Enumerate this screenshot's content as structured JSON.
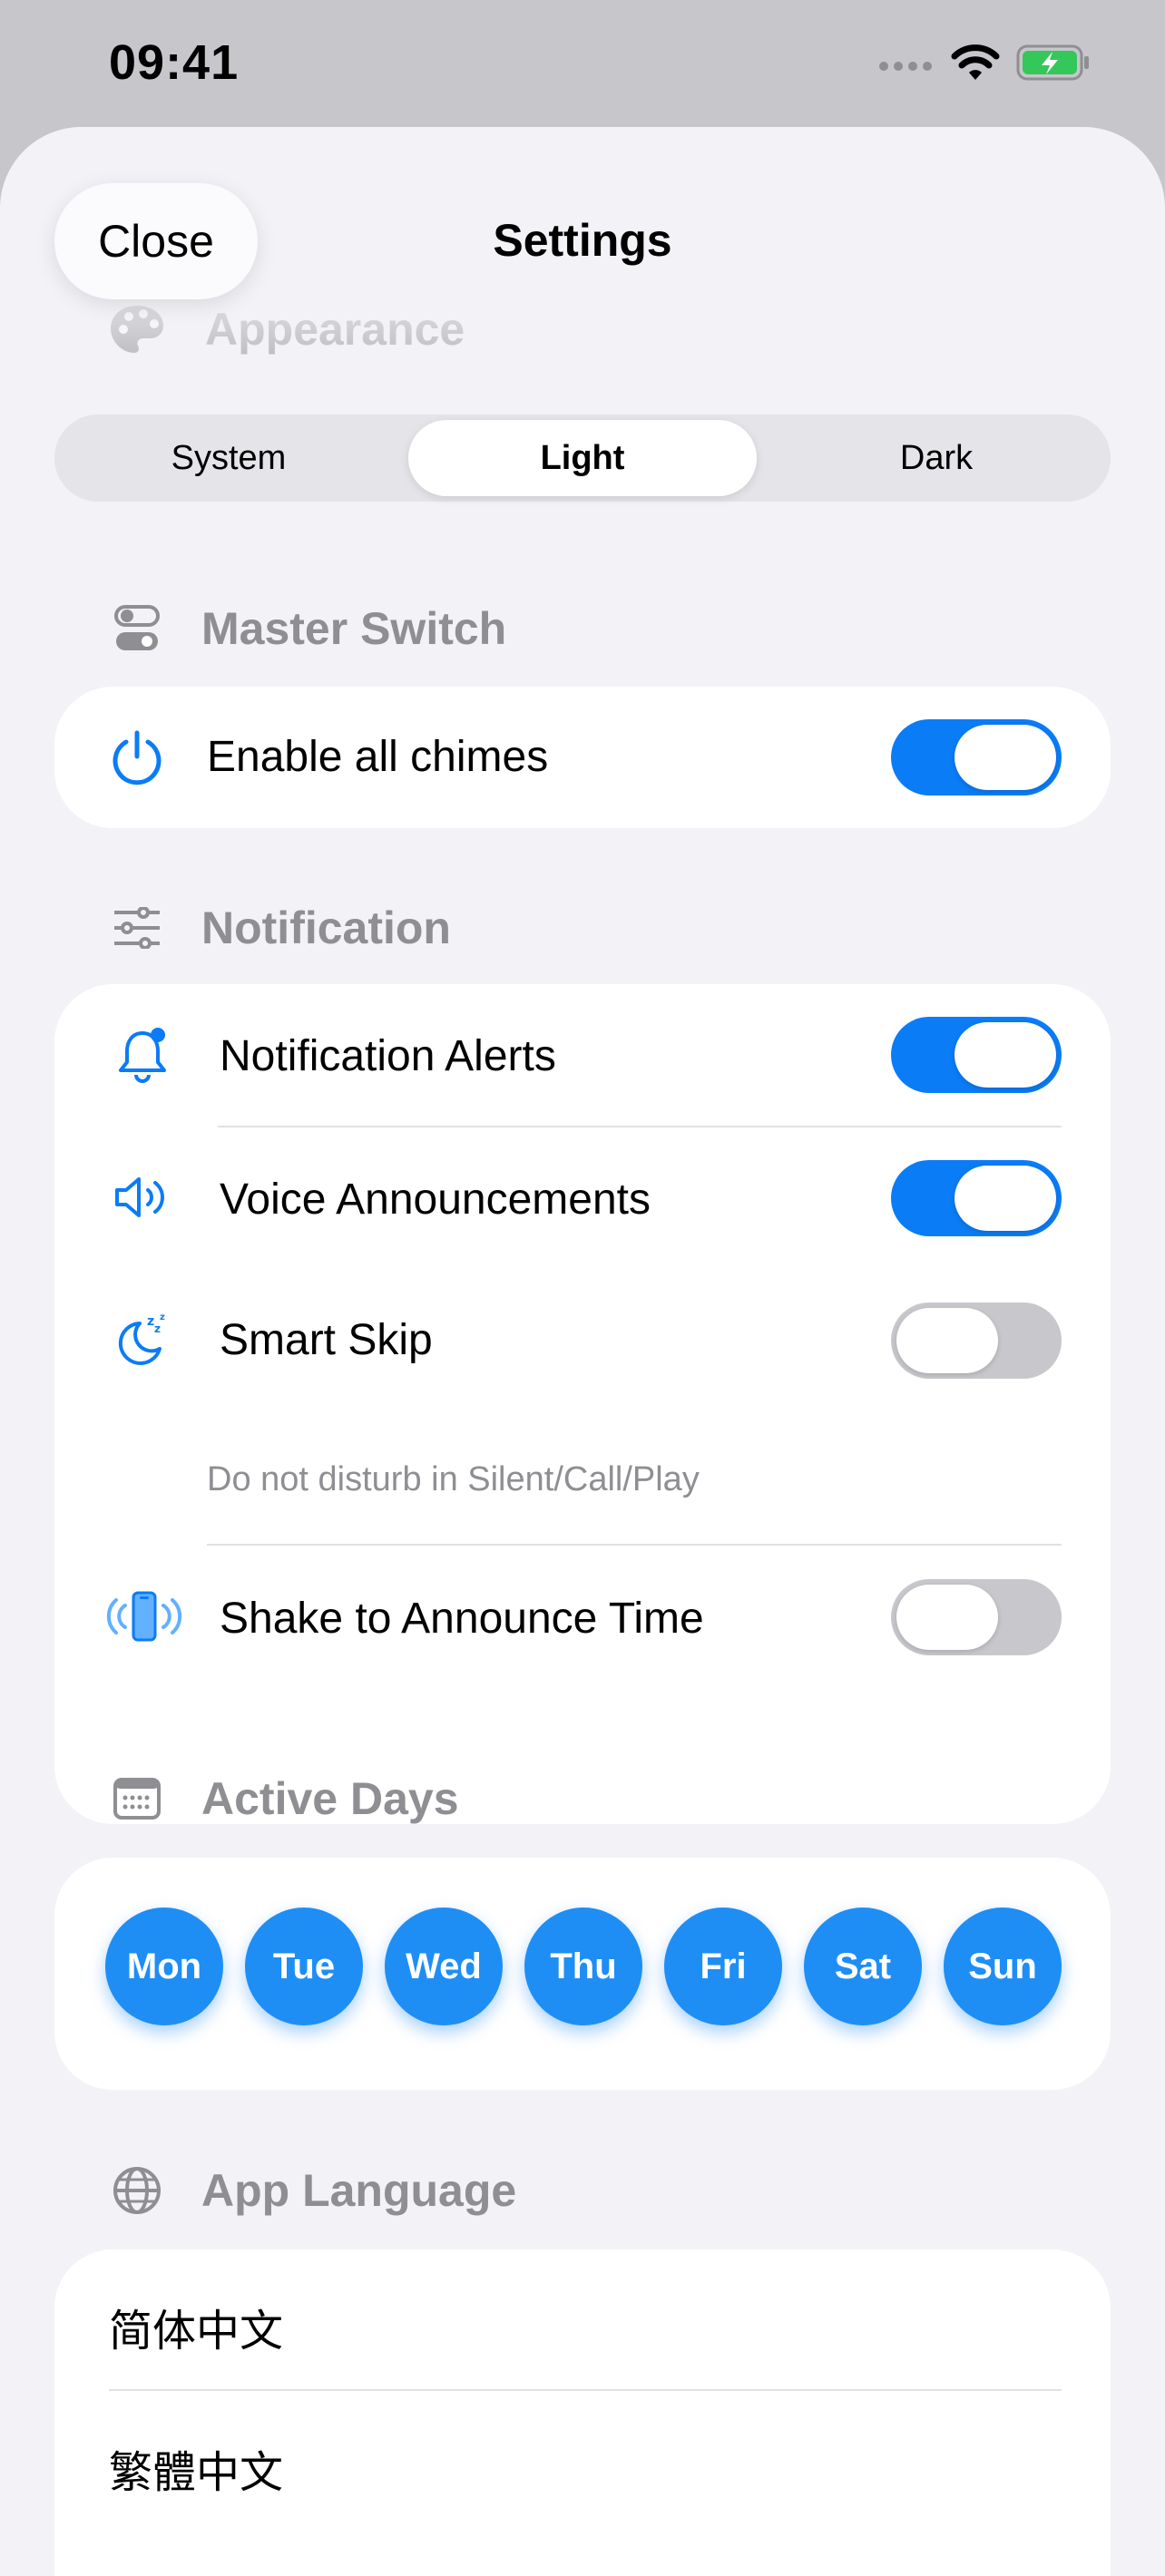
{
  "status": {
    "time": "09:41"
  },
  "nav": {
    "close_label": "Close",
    "title": "Settings"
  },
  "appearance": {
    "header": "Appearance",
    "options": [
      "System",
      "Light",
      "Dark"
    ],
    "selected": "Light"
  },
  "master": {
    "header": "Master Switch",
    "rows": [
      {
        "label": "Enable all chimes",
        "on": true,
        "icon": "power-icon"
      }
    ]
  },
  "notification": {
    "header": "Notification",
    "rows": [
      {
        "label": "Notification Alerts",
        "on": true,
        "icon": "bell-badge-icon"
      },
      {
        "label": "Voice Announcements",
        "on": true,
        "icon": "speaker-wave-icon"
      },
      {
        "label": "Smart Skip",
        "on": false,
        "icon": "moon-zzz-icon"
      },
      {
        "label": "Shake to Announce Time",
        "on": false,
        "icon": "phone-shake-icon"
      }
    ],
    "smart_skip_subtext": "Do not disturb in Silent/Call/Play"
  },
  "active_days": {
    "header": "Active Days",
    "days": [
      "Mon",
      "Tue",
      "Wed",
      "Thu",
      "Fri",
      "Sat",
      "Sun"
    ]
  },
  "language": {
    "header": "App Language",
    "options": [
      "简体中文",
      "繁體中文"
    ]
  },
  "colors": {
    "accent": "#0a7cf6",
    "day_fill": "#1e8ef5",
    "toggle_off": "#c7c7cc",
    "background": "#f2f2f7"
  }
}
